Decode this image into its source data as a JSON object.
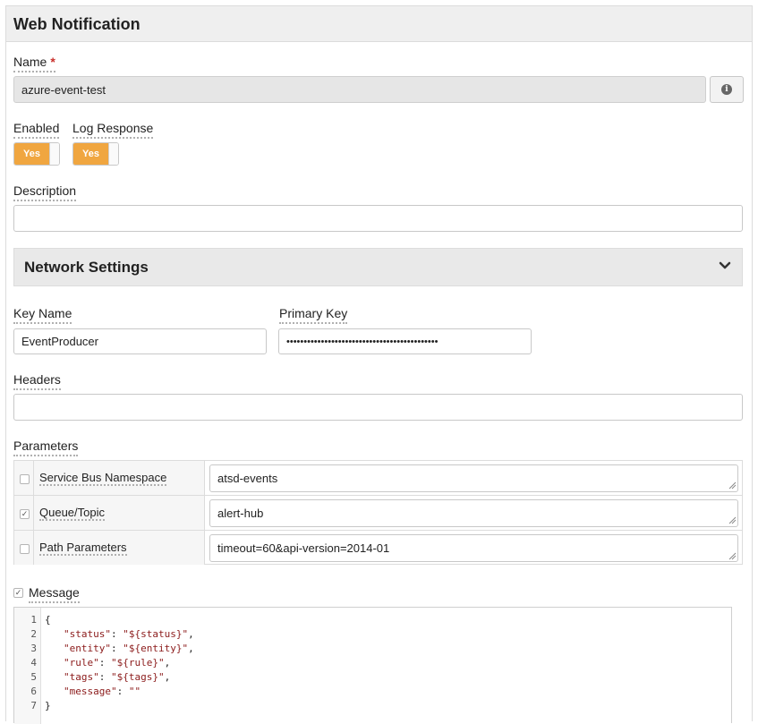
{
  "header": {
    "title": "Web Notification"
  },
  "name_field": {
    "label": "Name",
    "required_marker": "*",
    "value": "azure-event-test",
    "info_icon": "info-icon"
  },
  "enabled": {
    "label": "Enabled",
    "value": "Yes"
  },
  "log_response": {
    "label": "Log Response",
    "value": "Yes"
  },
  "description": {
    "label": "Description",
    "value": ""
  },
  "network_settings": {
    "title": "Network Settings",
    "chevron_icon": "chevron-down-icon"
  },
  "key_name": {
    "label": "Key Name",
    "value": "EventProducer"
  },
  "primary_key": {
    "label": "Primary Key",
    "value": "••••••••••••••••••••••••••••••••••••••••••••"
  },
  "headers": {
    "label": "Headers",
    "value": ""
  },
  "parameters": {
    "label": "Parameters",
    "rows": [
      {
        "name": "Service Bus Namespace",
        "value": "atsd-events",
        "checked": false
      },
      {
        "name": "Queue/Topic",
        "value": "alert-hub",
        "checked": true
      },
      {
        "name": "Path Parameters",
        "value": "timeout=60&api-version=2014-01",
        "checked": false
      }
    ]
  },
  "message": {
    "label": "Message",
    "checked": true,
    "lines": [
      {
        "no": "1",
        "key": "",
        "val": "",
        "text": "{"
      },
      {
        "no": "2",
        "key": "\"status\"",
        "val": "\"${status}\"",
        "sep": ": ",
        "tail": ","
      },
      {
        "no": "3",
        "key": "\"entity\"",
        "val": "\"${entity}\"",
        "sep": ": ",
        "tail": ","
      },
      {
        "no": "4",
        "key": "\"rule\"",
        "val": "\"${rule}\"",
        "sep": ": ",
        "tail": ","
      },
      {
        "no": "5",
        "key": "\"tags\"",
        "val": "\"${tags}\"",
        "sep": ": ",
        "tail": ","
      },
      {
        "no": "6",
        "key": "\"message\"",
        "val": "\"\"",
        "sep": ": ",
        "tail": ""
      },
      {
        "no": "7",
        "key": "",
        "val": "",
        "text": "}"
      }
    ]
  },
  "colors": {
    "accent": "#f0a640",
    "header_bg": "#efefef",
    "string": "#8b1a1a"
  }
}
